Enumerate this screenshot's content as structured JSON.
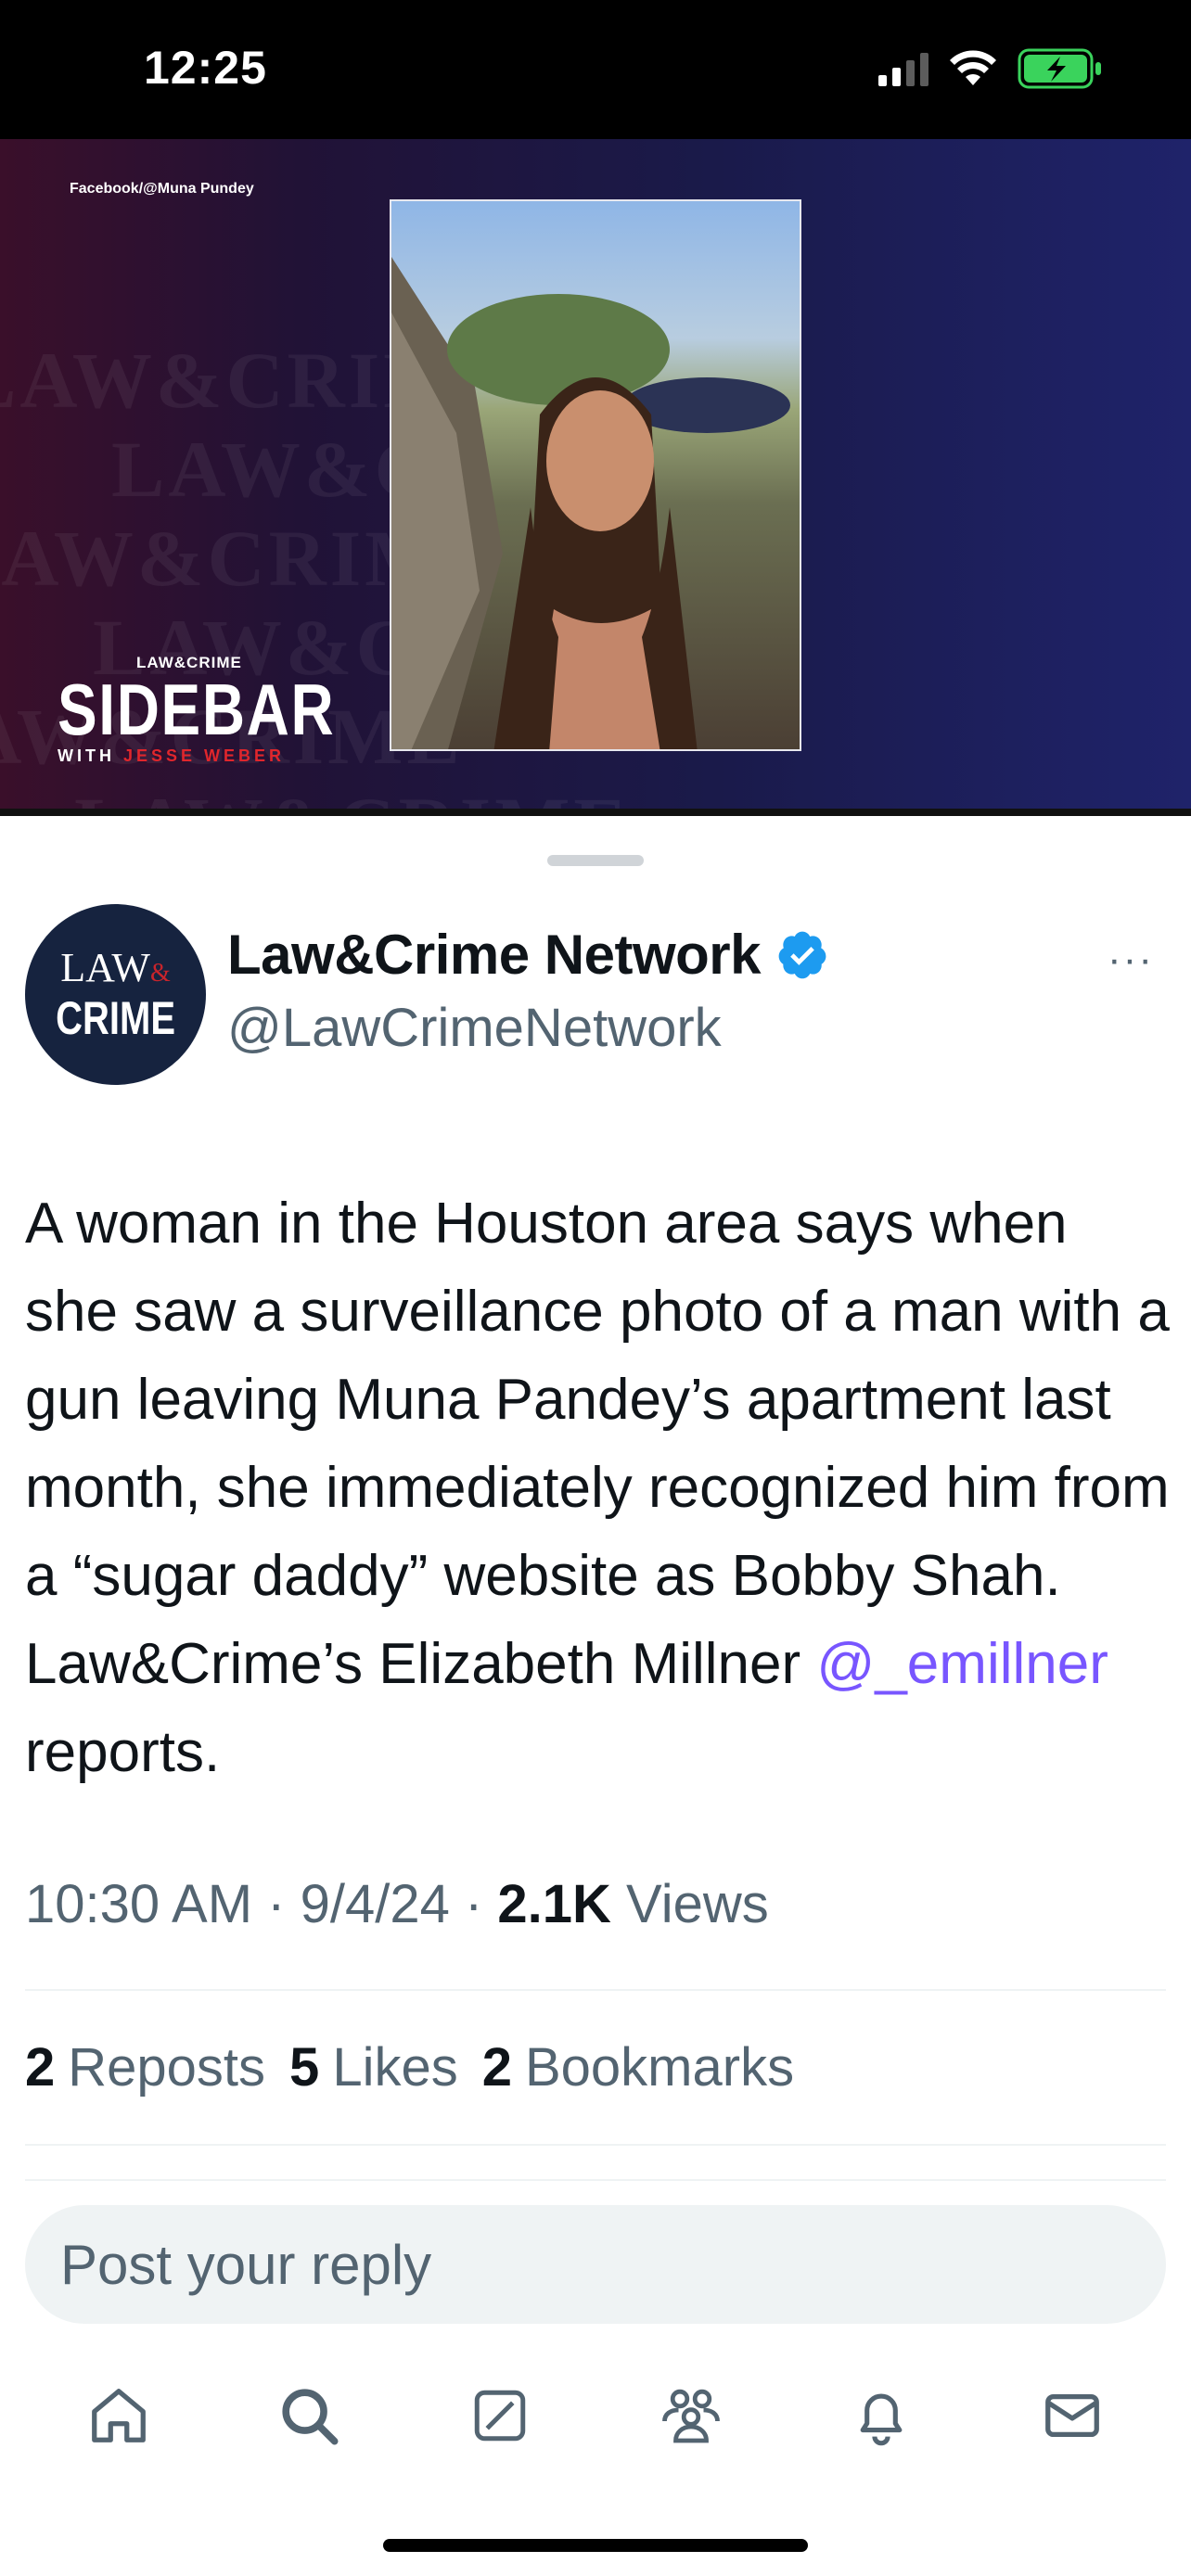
{
  "status_bar": {
    "time": "12:25"
  },
  "video": {
    "credit": "Facebook/@Muna Pundey",
    "watermark_text": "LAW&CRIME",
    "show": {
      "brand": "LAW&CRIME",
      "title": "SIDEBAR",
      "with": "WITH",
      "host": "JESSE WEBER"
    }
  },
  "author": {
    "avatar_line1": "LAW",
    "avatar_amp": "&",
    "avatar_line2": "CRIME",
    "name": "Law&Crime Network",
    "handle": "@LawCrimeNetwork",
    "more": "···"
  },
  "tweet": {
    "text_before": "A woman in the Houston area says when she saw a surveillance photo of a man with a gun leaving Muna Pandey’s apartment last month, she immediately recognized him from a “sugar daddy” website as Bobby Shah.   Law&Crime’s Elizabeth Millner ",
    "mention": "@_emillner",
    "text_after": " reports."
  },
  "meta": {
    "time": "10:30 AM",
    "sep1": " · ",
    "date": "9/4/24",
    "sep2": " · ",
    "views_count": "2.1K",
    "views_label": " Views"
  },
  "stats": [
    {
      "count": "2",
      "label": "Reposts"
    },
    {
      "count": "5",
      "label": "Likes"
    },
    {
      "count": "2",
      "label": "Bookmarks"
    }
  ],
  "reply": {
    "placeholder": "Post your reply"
  },
  "tabbar": {
    "icons": [
      "home-icon",
      "search-icon",
      "grok-icon",
      "communities-icon",
      "notifications-icon",
      "messages-icon"
    ]
  },
  "colors": {
    "link": "#7856ff",
    "verified": "#1d9bf0",
    "secondary_text": "#536471"
  }
}
